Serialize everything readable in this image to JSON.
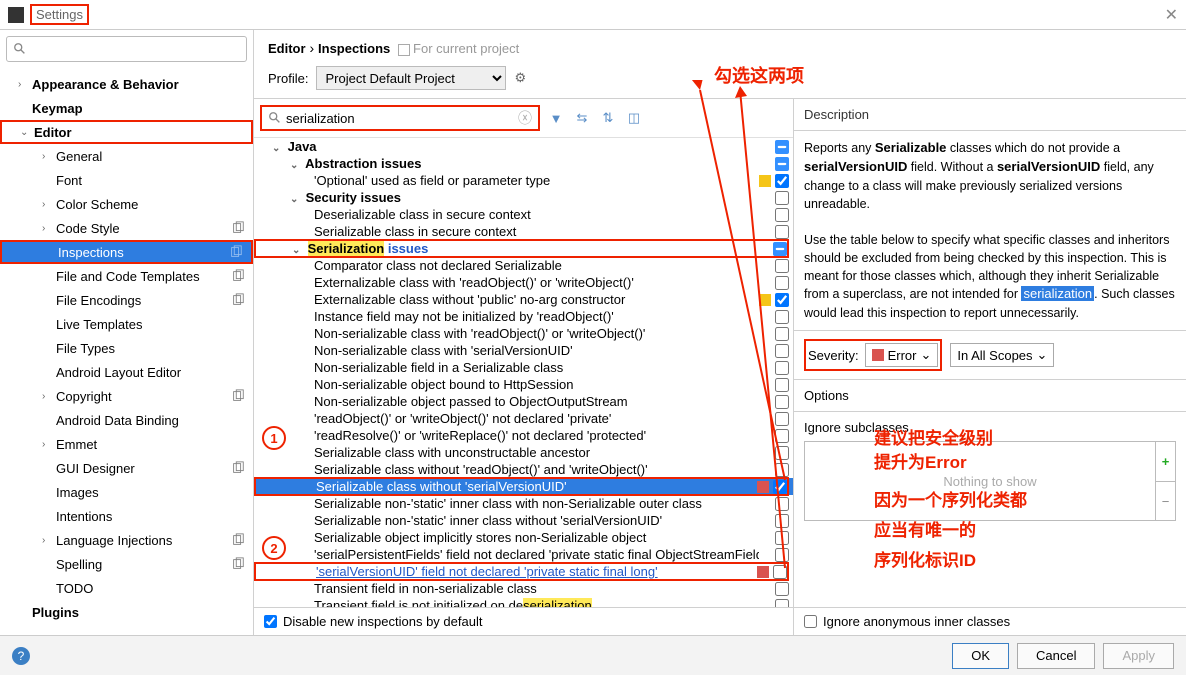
{
  "window": {
    "title": "Settings"
  },
  "sidebar": {
    "search_placeholder": "",
    "items": [
      {
        "label": "Appearance & Behavior",
        "bold": true,
        "chev": "›",
        "l": "l1"
      },
      {
        "label": "Keymap",
        "bold": true,
        "chev": "",
        "l": "l1"
      },
      {
        "label": "Editor",
        "bold": true,
        "chev": "⌄",
        "l": "l1",
        "box": true
      },
      {
        "label": "General",
        "chev": "›",
        "l": "l2"
      },
      {
        "label": "Font",
        "chev": "",
        "l": "l2"
      },
      {
        "label": "Color Scheme",
        "chev": "›",
        "l": "l2"
      },
      {
        "label": "Code Style",
        "chev": "›",
        "l": "l2",
        "copy": true
      },
      {
        "label": "Inspections",
        "chev": "",
        "l": "l2",
        "copy": true,
        "selected": true,
        "box": true
      },
      {
        "label": "File and Code Templates",
        "chev": "",
        "l": "l2",
        "copy": true
      },
      {
        "label": "File Encodings",
        "chev": "",
        "l": "l2",
        "copy": true
      },
      {
        "label": "Live Templates",
        "chev": "",
        "l": "l2"
      },
      {
        "label": "File Types",
        "chev": "",
        "l": "l2"
      },
      {
        "label": "Android Layout Editor",
        "chev": "",
        "l": "l2"
      },
      {
        "label": "Copyright",
        "chev": "›",
        "l": "l2",
        "copy": true
      },
      {
        "label": "Android Data Binding",
        "chev": "",
        "l": "l2"
      },
      {
        "label": "Emmet",
        "chev": "›",
        "l": "l2"
      },
      {
        "label": "GUI Designer",
        "chev": "",
        "l": "l2",
        "copy": true
      },
      {
        "label": "Images",
        "chev": "",
        "l": "l2"
      },
      {
        "label": "Intentions",
        "chev": "",
        "l": "l2"
      },
      {
        "label": "Language Injections",
        "chev": "›",
        "l": "l2",
        "copy": true
      },
      {
        "label": "Spelling",
        "chev": "",
        "l": "l2",
        "copy": true
      },
      {
        "label": "TODO",
        "chev": "",
        "l": "l2"
      },
      {
        "label": "Plugins",
        "bold": true,
        "chev": "",
        "l": "l1"
      }
    ]
  },
  "breadcrumb": {
    "a": "Editor",
    "b": "Inspections",
    "scope": "For current project"
  },
  "profile": {
    "label": "Profile:",
    "value": "Project Default  Project"
  },
  "insp_search": {
    "value": "serialization"
  },
  "insp_rows": [
    {
      "d": 0,
      "txt": "Java",
      "chev": "⌄",
      "cb": "tri"
    },
    {
      "d": 1,
      "txt": "Abstraction issues",
      "chev": "⌄",
      "cb": "tri"
    },
    {
      "d": 2,
      "txt": "'Optional' used as field or parameter type",
      "sev": "warn",
      "cb": "on"
    },
    {
      "d": 1,
      "txt": "Security issues",
      "chev": "⌄",
      "cb": "off"
    },
    {
      "d": 2,
      "txt": "Deserializable class in secure context",
      "cb": "off"
    },
    {
      "d": 2,
      "txt": "Serializable class in secure context",
      "cb": "off"
    },
    {
      "d": 1,
      "html": "<span class='chev2'>⌄</span> <span class='hl'>Serialization</span> <span class='link-blue'>issues</span>",
      "box": true,
      "cb": "tri"
    },
    {
      "d": 2,
      "txt": "Comparator class not declared Serializable",
      "cb": "off"
    },
    {
      "d": 2,
      "txt": "Externalizable class with 'readObject()' or 'writeObject()'",
      "cb": "off"
    },
    {
      "d": 2,
      "txt": "Externalizable class without 'public' no-arg constructor",
      "sev": "warn",
      "cb": "on"
    },
    {
      "d": 2,
      "txt": "Instance field may not be initialized by 'readObject()'",
      "cb": "off"
    },
    {
      "d": 2,
      "txt": "Non-serializable class with 'readObject()' or 'writeObject()'",
      "cb": "off"
    },
    {
      "d": 2,
      "txt": "Non-serializable class with 'serialVersionUID'",
      "cb": "off"
    },
    {
      "d": 2,
      "txt": "Non-serializable field in a Serializable class",
      "cb": "off"
    },
    {
      "d": 2,
      "txt": "Non-serializable object bound to HttpSession",
      "cb": "off"
    },
    {
      "d": 2,
      "txt": "Non-serializable object passed to ObjectOutputStream",
      "cb": "off"
    },
    {
      "d": 2,
      "txt": "'readObject()' or 'writeObject()' not declared 'private'",
      "cb": "off"
    },
    {
      "d": 2,
      "txt": "'readResolve()' or 'writeReplace()' not declared 'protected'",
      "cb": "off"
    },
    {
      "d": 2,
      "txt": "Serializable class with unconstructable ancestor",
      "cb": "off"
    },
    {
      "d": 2,
      "txt": "Serializable class without 'readObject()' and 'writeObject()'",
      "cb": "off"
    },
    {
      "d": 2,
      "txt": "Serializable class without 'serialVersionUID'",
      "sel": true,
      "box": true,
      "sev": "err",
      "cb": "on"
    },
    {
      "d": 2,
      "txt": "Serializable non-'static' inner class with non-Serializable outer class",
      "cb": "off"
    },
    {
      "d": 2,
      "txt": "Serializable non-'static' inner class without 'serialVersionUID'",
      "cb": "off"
    },
    {
      "d": 2,
      "txt": "Serializable object implicitly stores non-Serializable object",
      "cb": "off"
    },
    {
      "d": 2,
      "txt": "'serialPersistentFields' field not declared 'private static final ObjectStreamField[]'",
      "cb": "off"
    },
    {
      "d": 2,
      "html": "<span class='link-blue u'>'serialVersionUID' field not declared 'private static final long'</span>",
      "box": true,
      "sev": "err",
      "cb": "off"
    },
    {
      "d": 2,
      "txt": "Transient field in non-serializable class",
      "cb": "off"
    },
    {
      "d": 2,
      "html": "Transient field is not initialized on de<span class='hl'>serialization</span>",
      "cb": "off"
    }
  ],
  "disable_new": "Disable new inspections by default",
  "detail": {
    "desc_label": "Description",
    "desc_html": "Reports any <b>Serializable</b> classes which do not provide a <b>serialVersionUID</b> field. Without a <b>serialVersionUID</b> field, any change to a class will make previously serialized versions unreadable.<br><br>Use the table below to specify what specific classes and inheritors should be excluded from being checked by this inspection. This is meant for those classes which, although they inherit Serializable from a superclass, are not intended for <span class='hl2'>serialization</span>. Such classes would lead this inspection to report unnecessarily.",
    "severity_label": "Severity:",
    "severity_value": "Error",
    "scope_value": "In All Scopes",
    "options_label": "Options",
    "ignore_sub": "Ignore subclasses",
    "nothing": "Nothing to show",
    "ignore_anon": "Ignore anonymous inner classes"
  },
  "footer": {
    "ok": "OK",
    "cancel": "Cancel",
    "apply": "Apply"
  },
  "annotations": {
    "top": "勾选这两项",
    "right1": "建议把安全级别",
    "right2": "提升为Error",
    "right3": "因为一个序列化类都",
    "right4": "应当有唯一的",
    "right5": "序列化标识ID"
  }
}
